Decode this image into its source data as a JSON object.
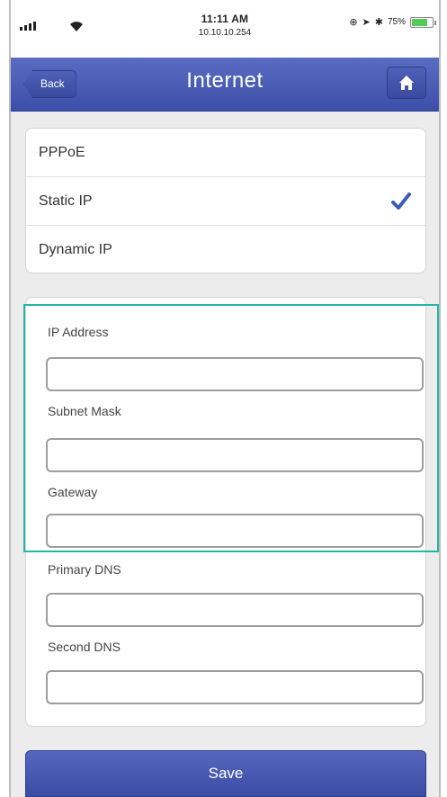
{
  "status_bar": {
    "time": "11:11 AM",
    "ip": "10.10.10.254",
    "battery": "75%",
    "battery_level": 0.75
  },
  "nav": {
    "back_label": "Back",
    "title": "Internet",
    "home_icon": "home-icon"
  },
  "connection_types": {
    "items": [
      {
        "label": "PPPoE",
        "selected": false
      },
      {
        "label": "Static IP",
        "selected": true
      },
      {
        "label": "Dynamic IP",
        "selected": false
      }
    ]
  },
  "form": {
    "fields": [
      {
        "label": "IP Address",
        "value": ""
      },
      {
        "label": "Subnet Mask",
        "value": ""
      },
      {
        "label": "Gateway",
        "value": ""
      },
      {
        "label": "Primary DNS",
        "value": ""
      },
      {
        "label": "Second DNS",
        "value": ""
      }
    ]
  },
  "save_label": "Save",
  "colors": {
    "nav_blue": "#4657b3",
    "check_blue": "#3b5bb8",
    "highlight": "#27b5a6"
  }
}
